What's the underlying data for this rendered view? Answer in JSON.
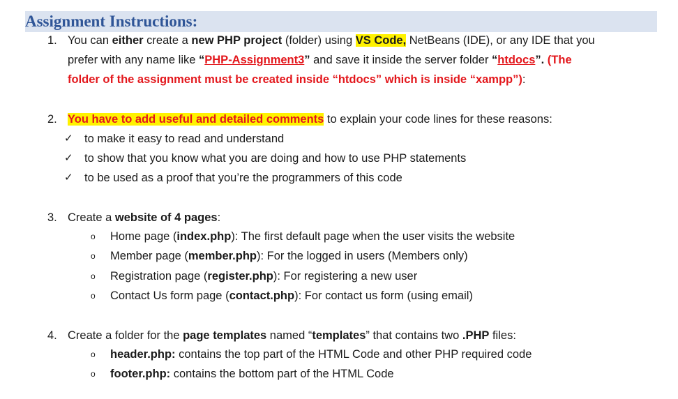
{
  "heading": "Assignment Instructions:",
  "items": [
    {
      "num": "1.",
      "l1": [
        "You can ",
        "either",
        " create a ",
        "new PHP project",
        " (folder) using ",
        "VS Code,",
        " NetBeans (IDE), or any IDE that you"
      ],
      "l2": [
        "prefer with any name like ",
        "“",
        "PHP-Assignment3",
        "”",
        " and save it inside the server folder ",
        "“",
        "htdocs",
        "”.",
        " (The"
      ],
      "l3": [
        "folder of the assignment must be created inside “htdocs” which is inside “xampp”)",
        ":"
      ]
    },
    {
      "num": "2.",
      "l1": [
        "You have to add useful and detailed comments",
        " to explain your code lines for these reasons:"
      ],
      "checks": [
        "to make it easy to read and understand",
        "to show that you know what you are doing and how to use PHP statements",
        "to be used as a proof that you’re the programmers of this code"
      ],
      "check_symbol": "✓"
    },
    {
      "num": "3.",
      "l1": [
        "Create a ",
        "website of 4 pages",
        ":"
      ],
      "bullets": [
        [
          "Home page (",
          "index.php",
          "): The first default page when the user visits the website"
        ],
        [
          "Member page (",
          "member.php",
          "): For the logged in users (Members only)"
        ],
        [
          "Registration page (",
          "register.php",
          "): For registering a new user"
        ],
        [
          "Contact Us form page (",
          "contact.php",
          "): For contact us form (using email)"
        ]
      ],
      "bullet_symbol": "o"
    },
    {
      "num": "4.",
      "l1": [
        "Create a folder for the ",
        "page templates",
        " named “",
        "templates",
        "” that contains two ",
        ".PHP",
        " files:"
      ],
      "bullets": [
        [
          "header.php:",
          " contains the top part of the HTML Code and other PHP required code"
        ],
        [
          "footer.php:",
          " contains the bottom part of the HTML Code"
        ]
      ],
      "bullet_symbol": "o"
    }
  ]
}
